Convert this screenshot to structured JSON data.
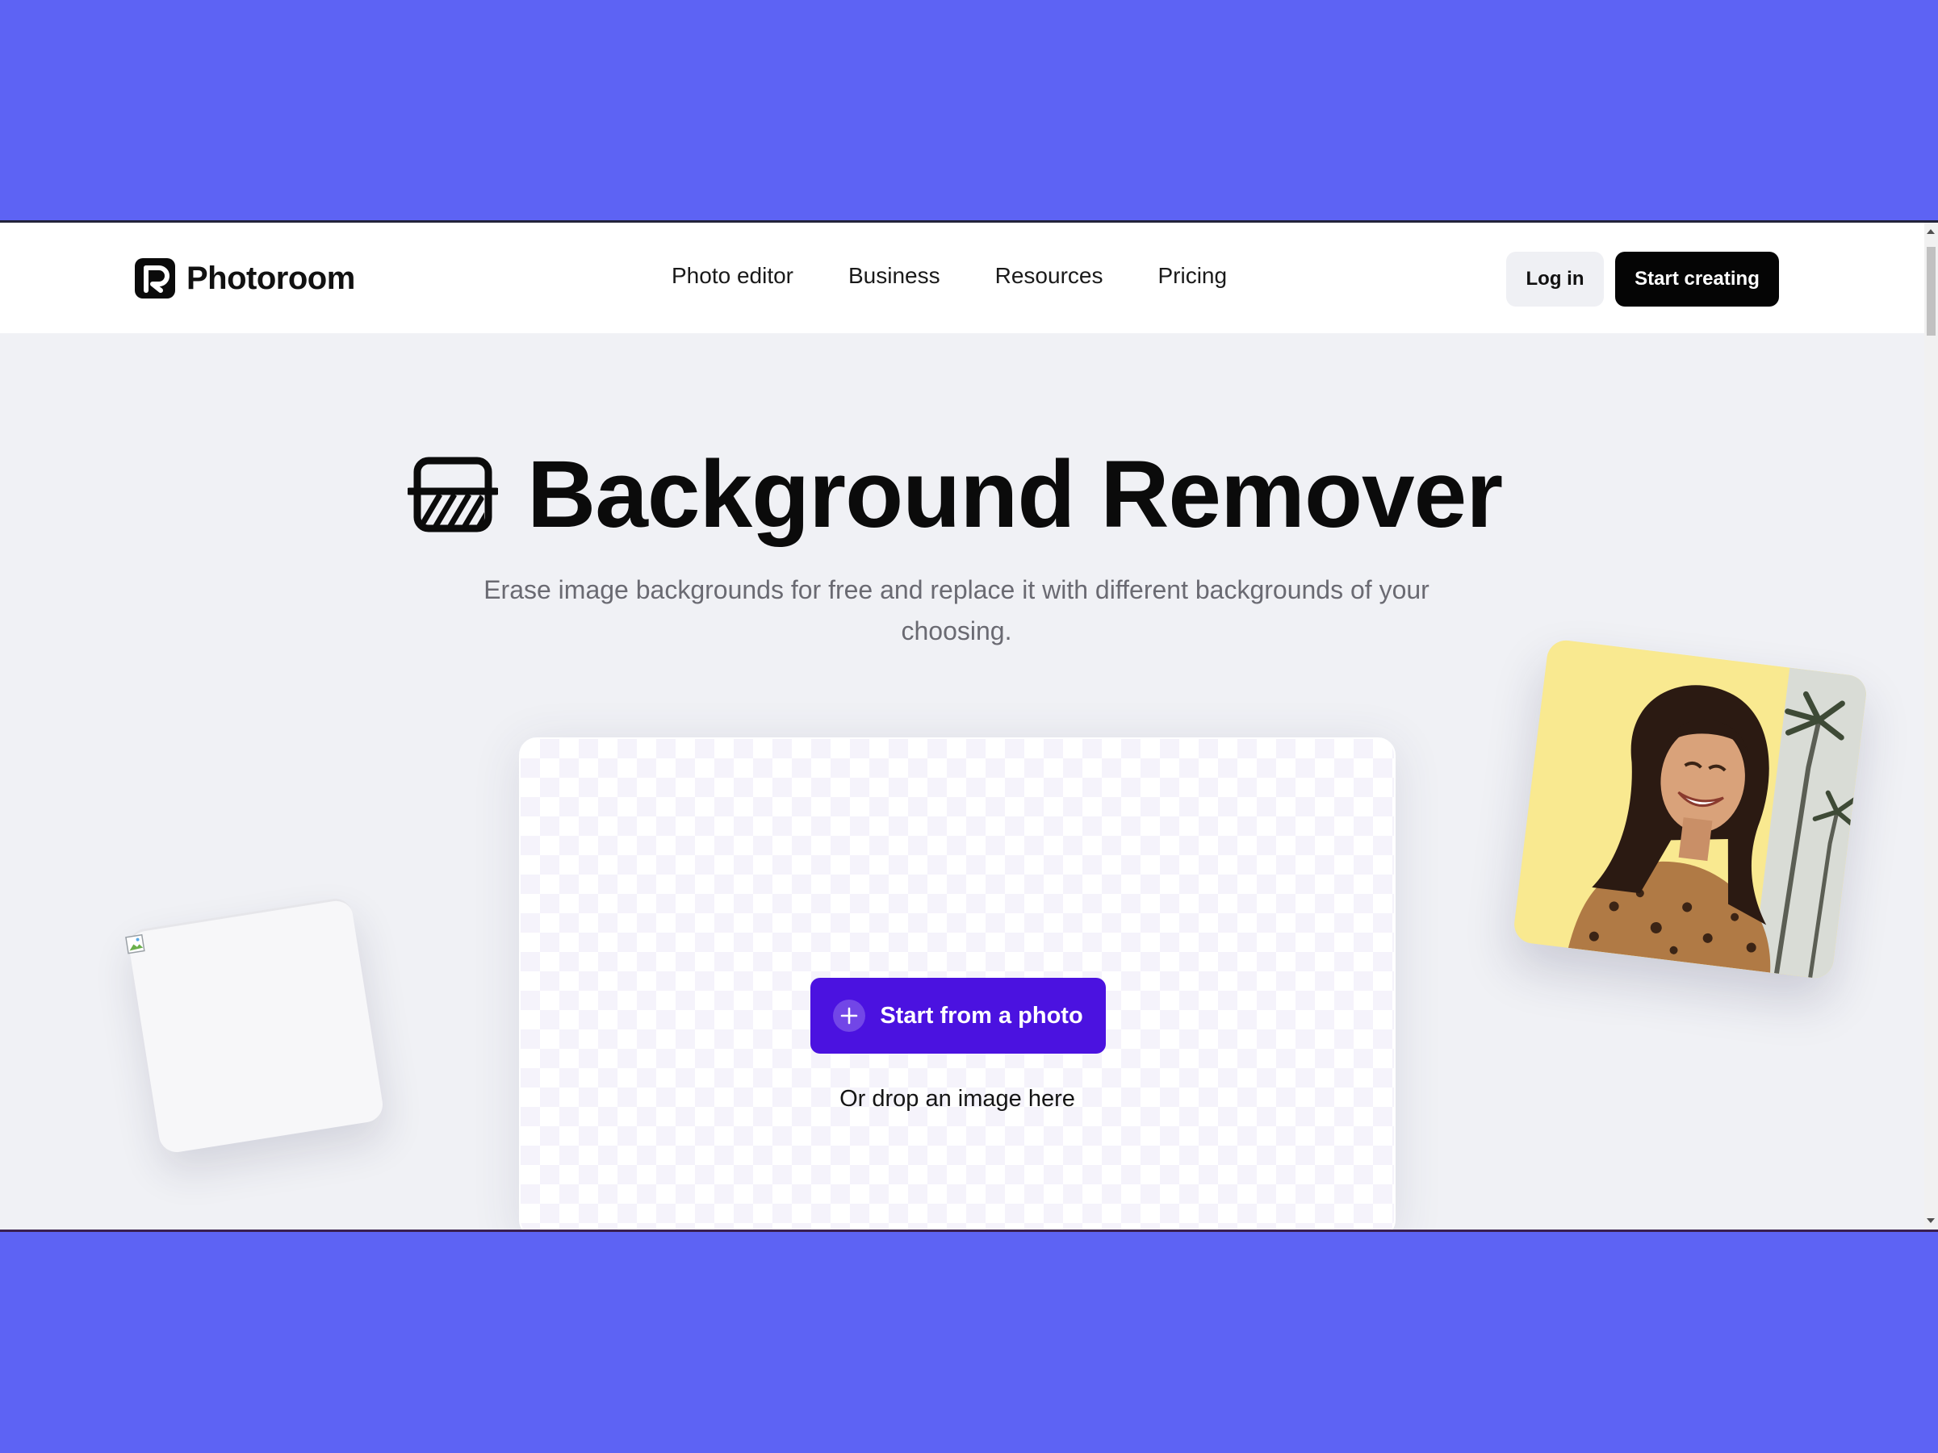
{
  "header": {
    "brand": "Photoroom",
    "nav": [
      "Photo editor",
      "Business",
      "Resources",
      "Pricing"
    ],
    "login_label": "Log in",
    "start_label": "Start creating"
  },
  "hero": {
    "title": "Background Remover",
    "subtitle": "Erase image backgrounds for free and replace it with different backgrounds of your choosing."
  },
  "upload": {
    "button_label": "Start from a photo",
    "drop_text": "Or drop an image here"
  },
  "colors": {
    "outer_background": "#5d63f4",
    "page_background": "#f0f1f5",
    "primary_button": "#4b12e0",
    "black_button": "#050505",
    "photo_card_background": "#f9e990"
  }
}
